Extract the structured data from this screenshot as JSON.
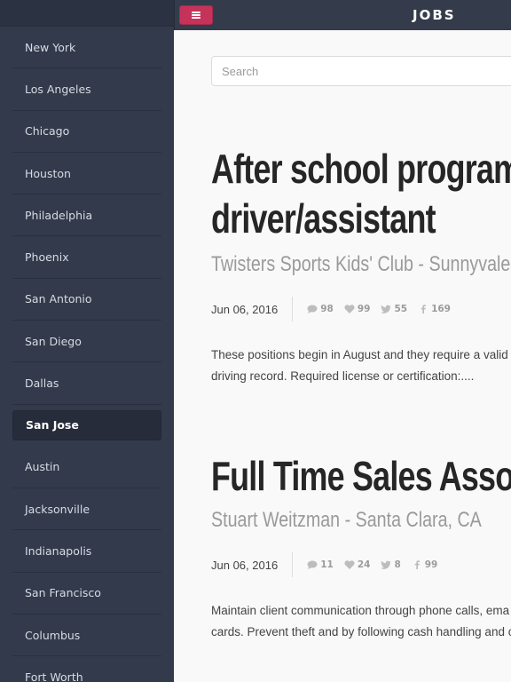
{
  "header": {
    "title": "JOBS",
    "menu_icon": "menu-icon",
    "accent_color": "#c5335b"
  },
  "sidebar": {
    "items": [
      {
        "label": "New York"
      },
      {
        "label": "Los Angeles"
      },
      {
        "label": "Chicago"
      },
      {
        "label": "Houston"
      },
      {
        "label": "Philadelphia"
      },
      {
        "label": "Phoenix"
      },
      {
        "label": "San Antonio"
      },
      {
        "label": "San Diego"
      },
      {
        "label": "Dallas"
      },
      {
        "label": "San Jose",
        "active": true
      },
      {
        "label": "Austin"
      },
      {
        "label": "Jacksonville"
      },
      {
        "label": "Indianapolis"
      },
      {
        "label": "San Francisco"
      },
      {
        "label": "Columbus"
      },
      {
        "label": "Fort Worth"
      }
    ]
  },
  "search": {
    "placeholder": "Search",
    "value": ""
  },
  "jobs": [
    {
      "title_line1": "After school program",
      "title_line2": "driver/assistant",
      "subtitle": "Twisters Sports Kids' Club - Sunnyvale, CA",
      "date": "Jun 06, 2016",
      "comments": "98",
      "likes": "99",
      "tweets": "55",
      "facebook": "169",
      "desc_line1": "These positions begin in August and they require a valid d",
      "desc_line2": "driving record. Required license or certification:...."
    },
    {
      "title_line1": "Full Time Sales Associate",
      "subtitle": "Stuart Weitzman - Santa Clara, CA",
      "date": "Jun 06, 2016",
      "comments": "11",
      "likes": "24",
      "tweets": "8",
      "facebook": "99",
      "desc_line1": "Maintain client communication through phone calls, ema",
      "desc_line2": "cards. Prevent theft and by following cash handling and c"
    }
  ]
}
